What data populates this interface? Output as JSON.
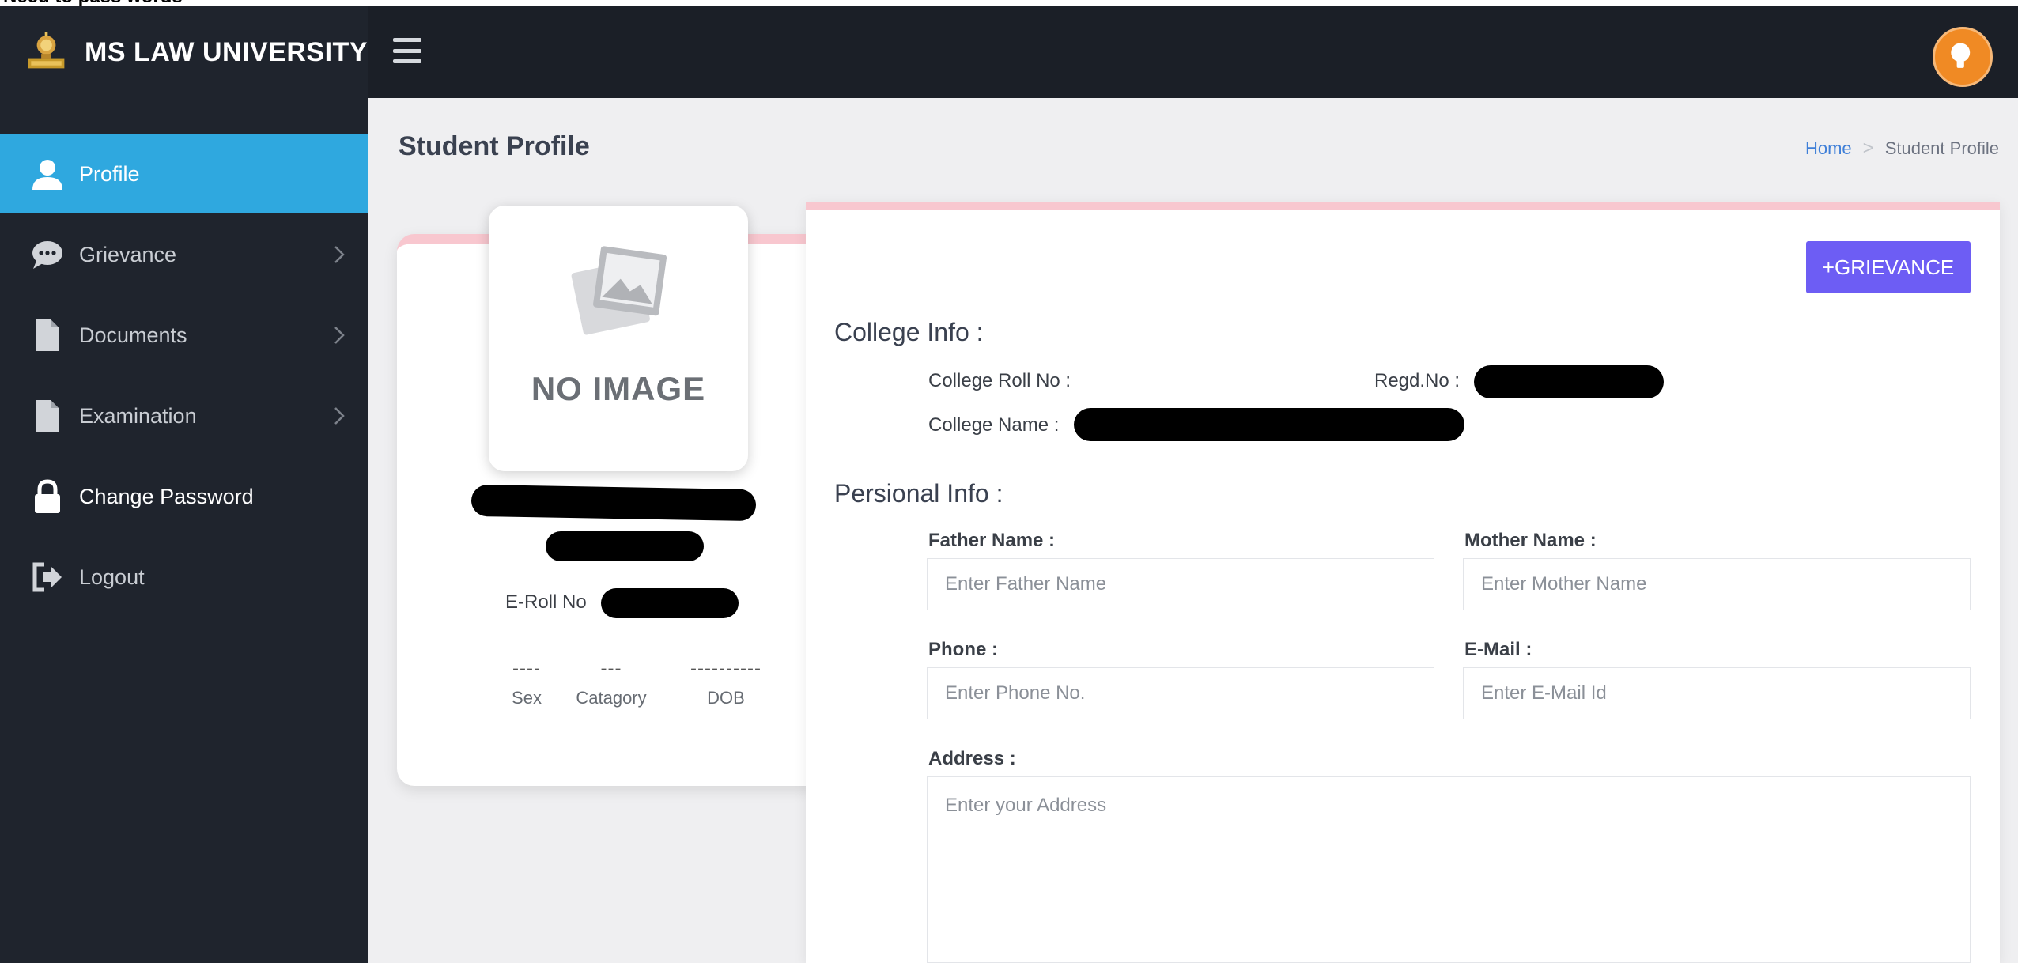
{
  "header": {
    "cut_text": "Need to pass words",
    "brand_name": "MS LAW UNIVERSITY"
  },
  "sidebar": {
    "items": [
      {
        "label": "Profile",
        "icon": "user-icon",
        "active": true
      },
      {
        "label": "Grievance",
        "icon": "chat-bubble-icon",
        "has_submenu": true
      },
      {
        "label": "Documents",
        "icon": "document-icon",
        "has_submenu": true
      },
      {
        "label": "Examination",
        "icon": "document-icon",
        "has_submenu": true
      },
      {
        "label": "Change Password",
        "icon": "lock-icon"
      },
      {
        "label": "Logout",
        "icon": "logout-icon"
      }
    ]
  },
  "page": {
    "title": "Student Profile",
    "breadcrumb": {
      "home": "Home",
      "separator": ">",
      "current": "Student Profile"
    }
  },
  "profile_card": {
    "no_image": "NO IMAGE",
    "eroll_label": "E-Roll No",
    "meta": [
      {
        "value": "----",
        "label": "Sex"
      },
      {
        "value": "---",
        "label": "Catagory"
      },
      {
        "value": "----------",
        "label": "DOB"
      }
    ]
  },
  "info": {
    "grievance_button": "+GRIEVANCE",
    "college": {
      "title": "College Info :",
      "roll_label": "College Roll No :",
      "regd_label": "Regd.No :",
      "name_label": "College Name :"
    },
    "personal": {
      "title": "Persional Info :",
      "father": {
        "label": "Father Name :",
        "placeholder": "Enter Father Name"
      },
      "mother": {
        "label": "Mother Name :",
        "placeholder": "Enter Mother Name"
      },
      "phone": {
        "label": "Phone :",
        "placeholder": "Enter Phone No."
      },
      "email": {
        "label": "E-Mail :",
        "placeholder": "Enter E-Mail Id"
      },
      "address": {
        "label": "Address :",
        "placeholder": "Enter your Address"
      }
    }
  },
  "colors": {
    "topbar": "#1b1f27",
    "sidebar": "#1f242d",
    "active_item": "#2fa8df",
    "button": "#6d5df4",
    "card_accent": "#f8c7cf",
    "avatar": "#f08a24"
  }
}
